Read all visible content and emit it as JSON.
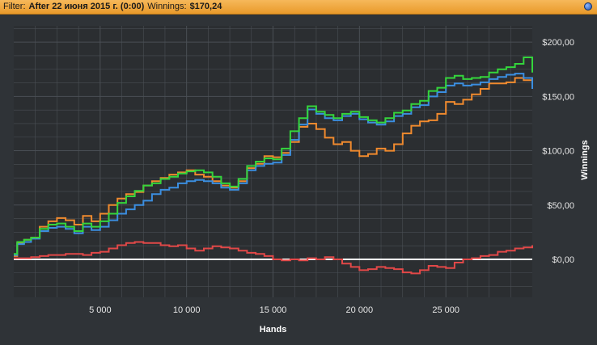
{
  "filter": {
    "label": "Filter:",
    "value": "After 22 июня 2015 г. (0:00)",
    "winnings_label": "Winnings:",
    "winnings_value": "$170,24"
  },
  "colors": {
    "background": "#2f3337",
    "plot_background": "#2b2e31",
    "grid": "#4a4f55",
    "zero_line": "#ffffff",
    "green": "#34d53c",
    "blue": "#3b8ee0",
    "orange": "#f08a2e",
    "red": "#e24848"
  },
  "chart_data": {
    "type": "line",
    "xlabel": "Hands",
    "ylabel": "Winnings",
    "xlim": [
      0,
      30000
    ],
    "ylim": [
      -35,
      215
    ],
    "x_ticks": [
      5000,
      10000,
      15000,
      20000,
      25000
    ],
    "x_tick_labels": [
      "5 000",
      "10 000",
      "15 000",
      "20 000",
      "25 000"
    ],
    "y_ticks": [
      0,
      50,
      100,
      150,
      200
    ],
    "y_tick_labels": [
      "$0,00",
      "$50,00",
      "$100,00",
      "$150,00",
      "$200,00"
    ],
    "grid": true,
    "legend": "none",
    "series": [
      {
        "color": "#f08a2e",
        "x": [
          0,
          200,
          600,
          1000,
          1500,
          2000,
          2500,
          3000,
          3500,
          4000,
          4500,
          5000,
          5500,
          6000,
          6500,
          7000,
          7500,
          8000,
          8500,
          9000,
          9500,
          10000,
          10500,
          11000,
          11500,
          12000,
          12500,
          13000,
          13500,
          14000,
          14500,
          15000,
          15500,
          16000,
          16500,
          17000,
          17500,
          18000,
          18500,
          19000,
          19500,
          20000,
          20500,
          21000,
          21500,
          22000,
          22500,
          23000,
          23500,
          24000,
          24500,
          25000,
          25500,
          26000,
          26500,
          27000,
          27500,
          28000,
          28500,
          29000,
          29500,
          30000
        ],
        "y": [
          3,
          15,
          18,
          20,
          30,
          35,
          38,
          36,
          32,
          40,
          35,
          42,
          50,
          56,
          60,
          62,
          68,
          72,
          75,
          78,
          80,
          82,
          78,
          76,
          72,
          68,
          66,
          72,
          84,
          88,
          95,
          94,
          98,
          108,
          122,
          125,
          120,
          112,
          106,
          108,
          100,
          95,
          97,
          102,
          100,
          106,
          116,
          123,
          127,
          128,
          134,
          145,
          143,
          147,
          152,
          157,
          162,
          162,
          163,
          167,
          165,
          160
        ]
      },
      {
        "color": "#3b8ee0",
        "x": [
          0,
          200,
          600,
          1000,
          1500,
          2000,
          2500,
          3000,
          3500,
          4000,
          4500,
          5000,
          5500,
          6000,
          6500,
          7000,
          7500,
          8000,
          8500,
          9000,
          9500,
          10000,
          10500,
          11000,
          11500,
          12000,
          12500,
          13000,
          13500,
          14000,
          14500,
          15000,
          15500,
          16000,
          16500,
          17000,
          17500,
          18000,
          18500,
          19000,
          19500,
          20000,
          20500,
          21000,
          21500,
          22000,
          22500,
          23000,
          23500,
          24000,
          24500,
          25000,
          25500,
          26000,
          26500,
          27000,
          27500,
          28000,
          28500,
          29000,
          29500,
          30000
        ],
        "y": [
          4,
          14,
          16,
          19,
          26,
          29,
          30,
          28,
          24,
          30,
          27,
          30,
          36,
          42,
          46,
          50,
          54,
          60,
          64,
          66,
          70,
          72,
          73,
          72,
          70,
          66,
          64,
          70,
          82,
          86,
          88,
          89,
          96,
          110,
          124,
          138,
          134,
          130,
          128,
          132,
          134,
          129,
          126,
          124,
          127,
          132,
          134,
          140,
          142,
          150,
          154,
          160,
          162,
          160,
          161,
          163,
          166,
          168,
          170,
          171,
          167,
          157
        ]
      },
      {
        "color": "#34d53c",
        "x": [
          0,
          200,
          600,
          1000,
          1500,
          2000,
          2500,
          3000,
          3500,
          4000,
          4500,
          5000,
          5500,
          6000,
          6500,
          7000,
          7500,
          8000,
          8500,
          9000,
          9500,
          10000,
          10500,
          11000,
          11500,
          12000,
          12500,
          13000,
          13500,
          14000,
          14500,
          15000,
          15500,
          16000,
          16500,
          17000,
          17500,
          18000,
          18500,
          19000,
          19500,
          20000,
          20500,
          21000,
          21500,
          22000,
          22500,
          23000,
          23500,
          24000,
          24500,
          25000,
          25500,
          26000,
          26500,
          27000,
          27500,
          28000,
          28500,
          29000,
          29500,
          30000
        ],
        "y": [
          5,
          16,
          18,
          20,
          28,
          32,
          33,
          30,
          26,
          33,
          30,
          35,
          42,
          52,
          58,
          63,
          68,
          70,
          74,
          76,
          79,
          81,
          82,
          80,
          76,
          70,
          67,
          74,
          86,
          90,
          93,
          92,
          102,
          118,
          130,
          141,
          136,
          133,
          130,
          134,
          136,
          131,
          128,
          126,
          130,
          135,
          137,
          143,
          146,
          155,
          158,
          167,
          169,
          166,
          167,
          168,
          172,
          175,
          177,
          180,
          186,
          172
        ]
      },
      {
        "color": "#e24848",
        "x": [
          0,
          500,
          1000,
          1500,
          2000,
          2500,
          3000,
          3500,
          4000,
          4500,
          5000,
          5500,
          6000,
          6500,
          7000,
          7500,
          8000,
          8500,
          9000,
          9500,
          10000,
          10500,
          11000,
          11500,
          12000,
          12500,
          13000,
          13500,
          14000,
          14500,
          15000,
          15500,
          16000,
          16500,
          17000,
          17500,
          18000,
          18500,
          19000,
          19500,
          20000,
          20500,
          21000,
          21500,
          22000,
          22500,
          23000,
          23500,
          24000,
          24500,
          25000,
          25500,
          26000,
          26500,
          27000,
          27500,
          28000,
          28500,
          29000,
          29500,
          30000
        ],
        "y": [
          1,
          1,
          2,
          3,
          4,
          4,
          5,
          5,
          4,
          6,
          7,
          10,
          13,
          15,
          16,
          15,
          15,
          13,
          12,
          13,
          10,
          8,
          10,
          12,
          11,
          10,
          8,
          6,
          5,
          3,
          0,
          -1,
          0,
          -1,
          1,
          0,
          2,
          0,
          -4,
          -7,
          -10,
          -9,
          -7,
          -8,
          -9,
          -12,
          -13,
          -10,
          -6,
          -7,
          -8,
          -3,
          0,
          1,
          3,
          4,
          7,
          8,
          10,
          11,
          13
        ]
      }
    ]
  }
}
